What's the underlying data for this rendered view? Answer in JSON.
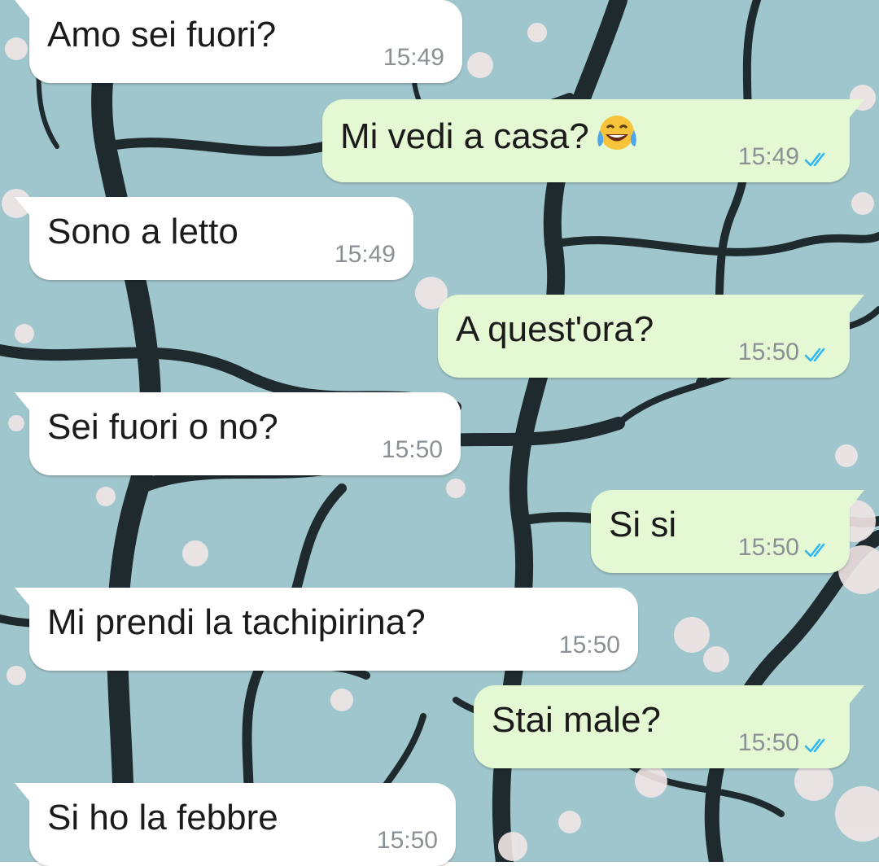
{
  "messages": [
    {
      "direction": "in",
      "text": "Amo sei fuori?",
      "time": "15:49"
    },
    {
      "direction": "out",
      "text": "Mi vedi a casa?",
      "time": "15:49",
      "emoji": "face-with-tears-of-joy-icon",
      "status": "read"
    },
    {
      "direction": "in",
      "text": "Sono a letto",
      "time": "15:49"
    },
    {
      "direction": "out",
      "text": "A quest'ora?",
      "time": "15:50",
      "status": "read"
    },
    {
      "direction": "in",
      "text": "Sei fuori o no?",
      "time": "15:50"
    },
    {
      "direction": "out",
      "text": "Si si",
      "time": "15:50",
      "status": "read"
    },
    {
      "direction": "in",
      "text": "Mi prendi la tachipirina?",
      "time": "15:50"
    },
    {
      "direction": "out",
      "text": "Stai male?",
      "time": "15:50",
      "status": "read"
    },
    {
      "direction": "in",
      "text": "Si ho la febbre",
      "time": "15:50"
    }
  ],
  "colors": {
    "incoming_bubble": "#ffffff",
    "outgoing_bubble": "#e4f8d4",
    "read_ticks": "#34b7f1",
    "timestamp": "#8b9095",
    "wallpaper_sky": "#9fc6cc"
  }
}
